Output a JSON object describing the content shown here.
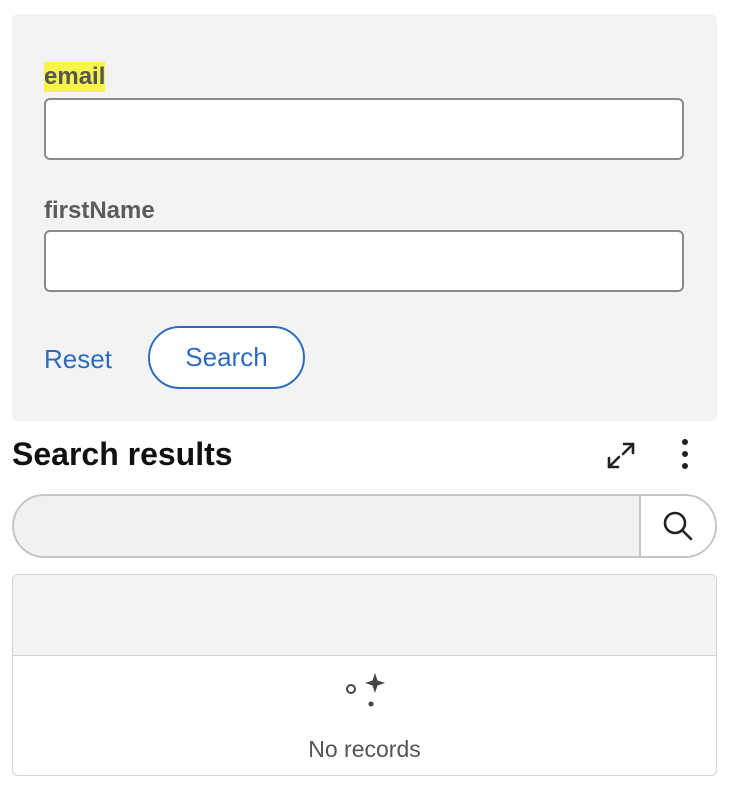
{
  "form": {
    "email_label": "email",
    "email_value": "",
    "firstname_label": "firstName",
    "firstname_value": "",
    "reset_label": "Reset",
    "search_label": "Search"
  },
  "results": {
    "title": "Search results",
    "search_value": "",
    "empty_text": "No records"
  },
  "icons": {
    "expand": "expand-icon",
    "more": "more-vertical-icon",
    "search": "search-icon",
    "empty": "sparkle-empty-icon"
  },
  "colors": {
    "accent": "#2e6bbf",
    "highlight": "#f8f54a",
    "panel_bg": "#f3f3f3"
  }
}
